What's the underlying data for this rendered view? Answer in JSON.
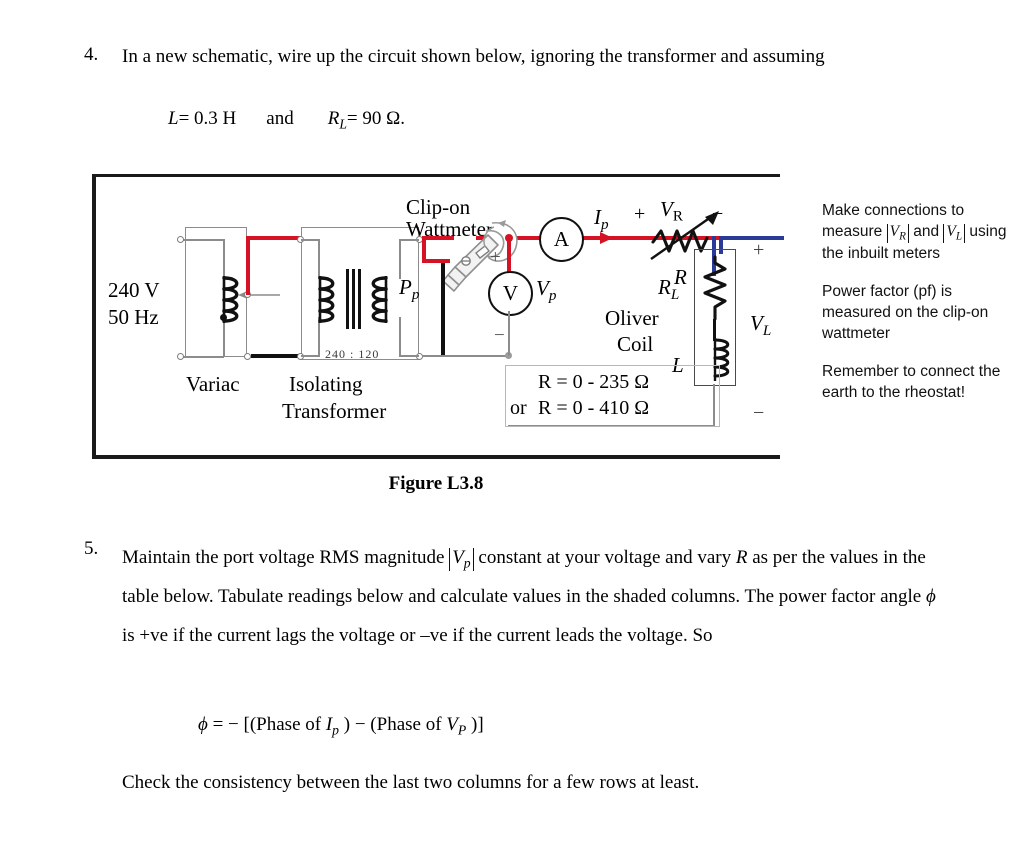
{
  "question4": {
    "number": "4.",
    "text": "In a new schematic, wire up the circuit shown below, ignoring the transformer and assuming",
    "given": {
      "l_symbol": "L",
      "l_value": "= 0.3 H",
      "and": "and",
      "rl_symbol": "R",
      "rl_sub": "L",
      "rl_value": "= 90 Ω."
    }
  },
  "figure": {
    "caption": "Figure L3.8",
    "source": {
      "voltage": "240 V",
      "frequency": "50 Hz"
    },
    "labels": {
      "variac": "Variac",
      "isolating": "Isolating",
      "transformer": "Transformer",
      "turns_ratio": "240 : 120",
      "clip_on": "Clip-on",
      "wattmeter": "Wattmeter",
      "power_p": "P",
      "power_p_sub": "p",
      "ammeter": "A",
      "voltmeter": "V",
      "vp_symbol": "V",
      "vp_sub": "p",
      "ip_symbol": "I",
      "ip_sub": "p",
      "vr_symbol": "V",
      "vr_sub": "R",
      "r_symbol": "R",
      "rl_symbol": "R",
      "rl_sub": "L",
      "l_symbol": "L",
      "oliver": "Oliver",
      "coil": "Coil",
      "vl_symbol": "V",
      "vl_sub": "L",
      "plus_vp": "+",
      "minus_vp": "−",
      "plus_vr": "+",
      "minus_vr": "−",
      "plus_vl": "+",
      "minus_vl": "−"
    },
    "rheostat_range": {
      "line1": "R = 0 - 235 Ω",
      "or": "or",
      "line2": "R = 0 - 410 Ω"
    }
  },
  "annotations": [
    {
      "id": "measure-note",
      "pre": "Make connections to measure ",
      "sym1": "V",
      "sym1_sub": "R",
      "mid": " and",
      "sym2": "V",
      "sym2_sub": "L",
      "post": " using the inbuilt meters"
    },
    {
      "id": "pf-note",
      "text": "Power factor (pf) is measured on the clip-on wattmeter"
    },
    {
      "id": "earth-note",
      "text": "Remember to connect the earth to the rheostat!"
    }
  ],
  "question5": {
    "number": "5.",
    "line1_a": "Maintain the port voltage RMS magnitude ",
    "line1_sym": "V",
    "line1_sym_sub": "p",
    "line1_b": " constant at your voltage and vary ",
    "line1_italic": "R",
    "line1_c": " as per",
    "line2": "the values in the table below. Tabulate readings below and calculate values in the shaded",
    "line3_a": "columns. The power factor angle ",
    "line3_phi": "ϕ",
    "line3_b": " is +ve if the current lags the voltage or –ve if the current",
    "line4": "leads the voltage. So",
    "formula": {
      "phi": "ϕ",
      "eq": "= − [(Phase of ",
      "i": "I",
      "i_sub": "p",
      "mid": " ) − (Phase of ",
      "v": "V",
      "v_sub": "P",
      "end": " )]"
    },
    "last": "Check the consistency between the last two columns for a few rows at least."
  },
  "colors": {
    "wire_red": "#d51324",
    "wire_blue": "#2b3a96",
    "wire_gray": "#8c8c8c",
    "wire_black": "#101010",
    "frame": "#1a1a1a"
  }
}
